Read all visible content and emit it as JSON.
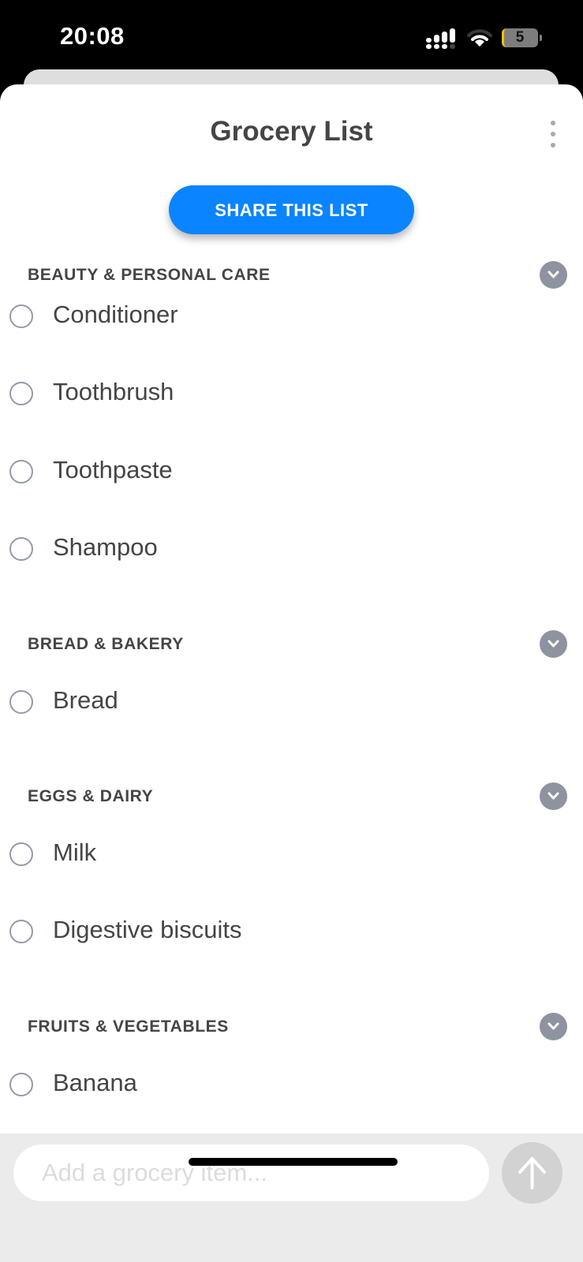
{
  "status_bar": {
    "time": "20:08",
    "signal_icon": "cellular-signal-icon",
    "wifi_icon": "wifi-icon",
    "battery_level": "5"
  },
  "header": {
    "title": "Grocery List",
    "more_icon": "more-vertical-icon"
  },
  "share_button": {
    "label": "SHARE THIS LIST"
  },
  "sections": [
    {
      "title": "BEAUTY & PERSONAL CARE",
      "items": [
        "Conditioner",
        "Toothbrush",
        "Toothpaste",
        "Shampoo"
      ]
    },
    {
      "title": "BREAD & BAKERY",
      "items": [
        "Bread"
      ]
    },
    {
      "title": "EGGS & DAIRY",
      "items": [
        "Milk",
        "Digestive biscuits"
      ]
    },
    {
      "title": "FRUITS & VEGETABLES",
      "items": [
        "Banana"
      ]
    }
  ],
  "composer": {
    "placeholder": "Add a grocery item...",
    "value": "",
    "send_icon": "arrow-up-icon"
  },
  "colors": {
    "accent": "#0a84ff",
    "text": "#454545",
    "toggle": "#8e93a0",
    "composer_bg": "#ebebeb"
  }
}
